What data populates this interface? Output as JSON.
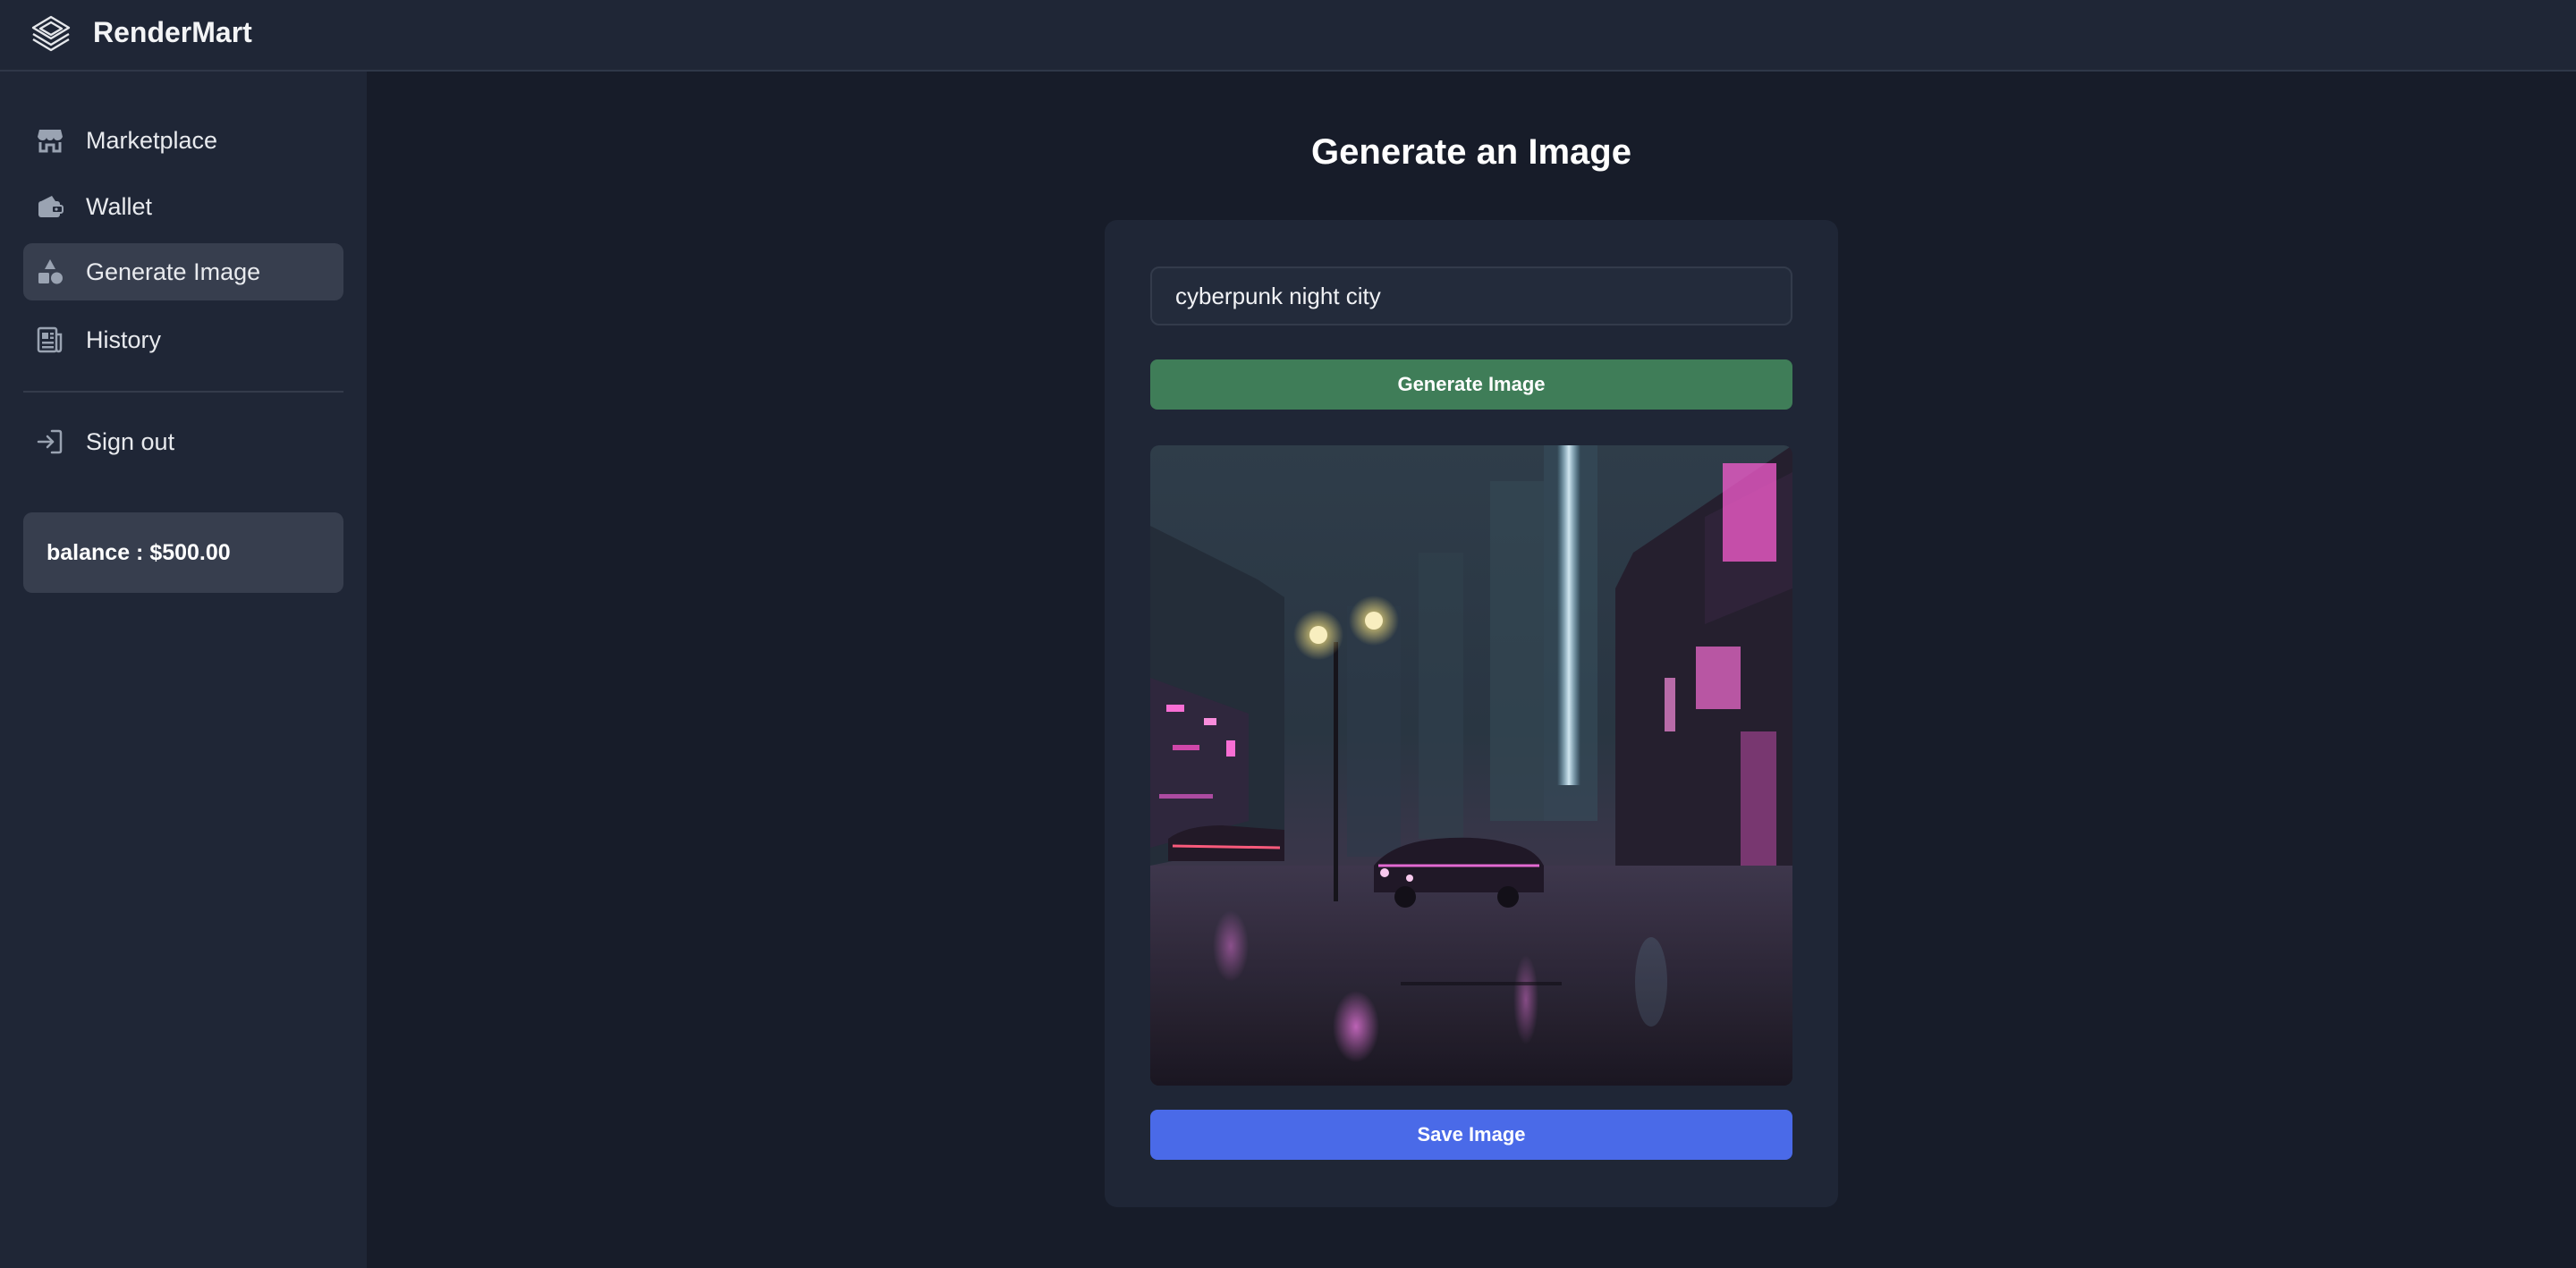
{
  "app": {
    "brand": "RenderMart"
  },
  "sidebar": {
    "items": [
      {
        "label": "Marketplace",
        "icon": "store-icon"
      },
      {
        "label": "Wallet",
        "icon": "wallet-icon"
      },
      {
        "label": "Generate Image",
        "icon": "shapes-icon",
        "active": true
      },
      {
        "label": "History",
        "icon": "newspaper-icon"
      },
      {
        "label": "Sign out",
        "icon": "sign-in-icon"
      }
    ],
    "balance": "balance : $500.00"
  },
  "main": {
    "title": "Generate an Image",
    "prompt_value": "cyberpunk night city",
    "generate_label": "Generate Image",
    "save_label": "Save Image"
  },
  "colors": {
    "background": "#171c29",
    "sidebar": "#1f2636",
    "active_item": "#373e4e",
    "generate_button": "#3f7d58",
    "save_button": "#4a6ae8"
  }
}
